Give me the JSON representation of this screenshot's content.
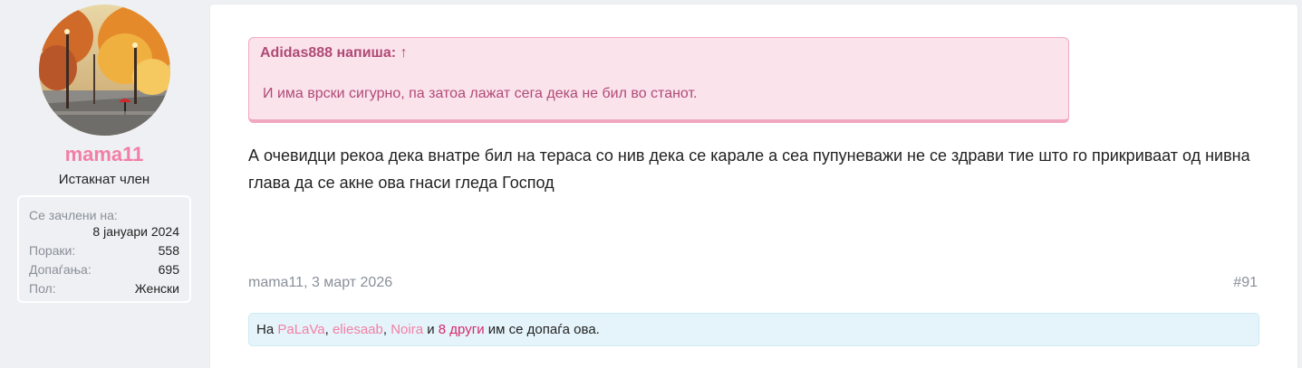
{
  "user": {
    "name": "mama11",
    "title": "Истакнат член",
    "stats": {
      "joined_label": "Се зачлени на:",
      "joined_value": "8 јануари 2024",
      "messages_label": "Пораки:",
      "messages_value": "558",
      "reactions_label": "Допаѓања:",
      "reactions_value": "695",
      "gender_label": "Пол:",
      "gender_value": "Женски"
    }
  },
  "quote": {
    "author_line": "Adidas888 напиша:",
    "arrow": "↑",
    "text": "И има врски сигурно, па затоа лажат сега дека не бил во станот."
  },
  "message": {
    "text": "А очевидци рекоа дека внатре бил на тераса со нив дека се карале а сеа пупуневажи не се здрави тие што го прикриваат од нивна глава да се акне ова гнаси гледа Господ"
  },
  "meta": {
    "author_date": "mama11, 3 март 2026",
    "post_number": "#91"
  },
  "likes": {
    "prefix": "На",
    "users": [
      "PaLaVa",
      "eliesaab",
      "Noira"
    ],
    "sep1": ",",
    "sep2": ",",
    "and": "и",
    "others": "8 други",
    "suffix": "им се допаѓа ова."
  },
  "colors": {
    "username": "#f27fa5",
    "quote_bg": "#fbe3ec",
    "quote_text": "#b04a75",
    "likes_bg": "#e5f4fb"
  }
}
